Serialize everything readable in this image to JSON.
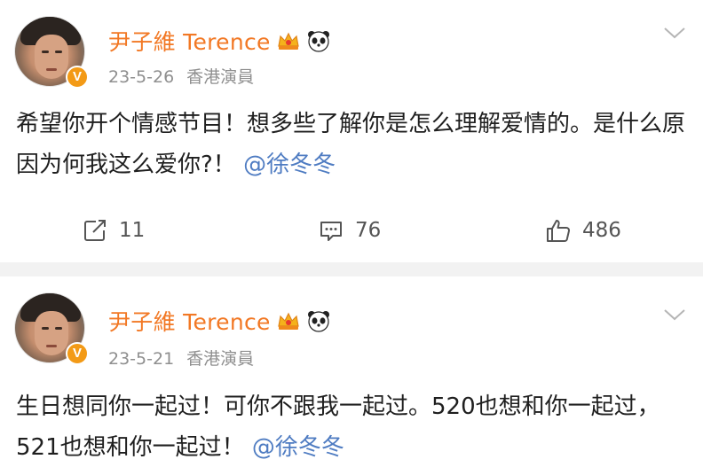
{
  "posts": [
    {
      "user": {
        "name": "尹子維 Terence",
        "badges": [
          "crown-icon",
          "panda-icon"
        ],
        "verified": "V"
      },
      "date": "23-5-26",
      "source": "香港演員",
      "text": "希望你开个情感节目！想多些了解你是怎么理解爱情的。是什么原因为何我这么爱你?！",
      "mention": "@徐冬冬",
      "actions": {
        "repost": "11",
        "comment": "76",
        "like": "486"
      }
    },
    {
      "user": {
        "name": "尹子維 Terence",
        "badges": [
          "crown-icon",
          "panda-icon"
        ],
        "verified": "V"
      },
      "date": "23-5-21",
      "source": "香港演員",
      "text": "生日想同你一起过！可你不跟我一起过。520也想和你一起过，521也想和你一起过！",
      "mention": "@徐冬冬"
    }
  ],
  "colors": {
    "name": "#f27824",
    "mention": "#4f7cc2",
    "meta": "#8f8f8f",
    "separator": "#f2f2f2",
    "verified": "#f39a16"
  }
}
